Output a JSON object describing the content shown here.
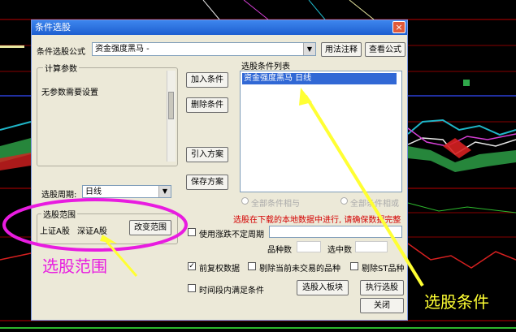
{
  "dialog": {
    "title": "条件选股",
    "close_glyph": "×",
    "formula_label": "条件选股公式",
    "formula_value": "资金强度黑马 -",
    "help_button": "用法注释",
    "view_formula_button": "查看公式",
    "params_group": "计算参数",
    "params_text": "无参数需要设置",
    "period_label": "选股周期:",
    "period_value": "日线",
    "range_group": "选股范围",
    "range_items": [
      "上证A股",
      "深证A股"
    ],
    "change_range_button": "改变范围",
    "add_condition_button": "加入条件",
    "delete_condition_button": "删除条件",
    "load_scheme_button": "引入方案",
    "save_scheme_button": "保存方案",
    "condition_list_label": "选股条件列表",
    "condition_items": [
      "资金强度黑马  日线"
    ],
    "radio_and": "全部条件相与",
    "radio_or": "全部条件相或",
    "warning_text": "选股在下载的本地数据中进行, 请确保数据完整",
    "uncertain_period_label": "使用涨跌不定周期",
    "stock_count_label": "品种数",
    "selected_count_label": "选中数",
    "checkbox_pre_adjust": "前复权数据",
    "checkbox_exclude_untraded": "剔除当前未交易的品种",
    "checkbox_exclude_st": "剔除ST品种",
    "checkbox_period_satisfy": "时间段内满足条件",
    "to_sector_button": "选股入板块",
    "execute_button": "执行选股",
    "close_button": "关闭",
    "checked_glyph": "✓",
    "dropdown_glyph": "▼"
  },
  "annotations": {
    "range_note": "选股范围",
    "condition_note": "选股条件"
  },
  "colors": {
    "annotation_magenta": "#e81ce0",
    "annotation_yellow": "#ffff33",
    "selection_blue": "#3168d5",
    "warning_red": "#d40000"
  }
}
